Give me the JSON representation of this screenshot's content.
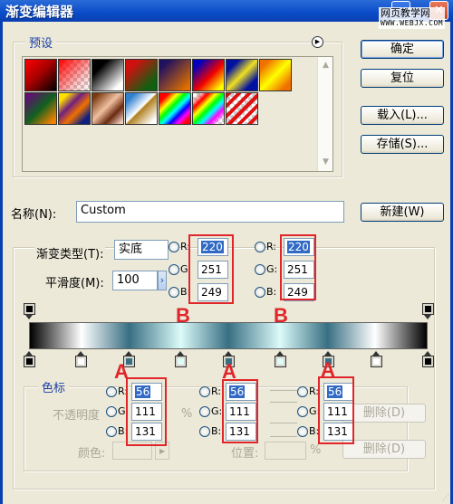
{
  "window": {
    "title": "渐变编辑器",
    "close_glyph": "✕",
    "watermark_line1": "网页教学网",
    "watermark_line2": "WWW.WEBJX.COM"
  },
  "presets": {
    "label": "预设",
    "menu_icon": "▶",
    "swatches": [
      {
        "name": "foreground-to-background",
        "css": "linear-gradient(135deg,#f00 0%,#a00 45%,#000 100%)"
      },
      {
        "name": "foreground-to-transparent",
        "css": "linear-gradient(135deg,#f00 0%,rgba(255,0,0,0.2) 70%,rgba(255,255,255,0) 100%), repeating-conic-gradient(#ccc 0% 25%, #fff 0% 50%) 0 0/8px 8px"
      },
      {
        "name": "black-white",
        "css": "linear-gradient(135deg,#000 25%,#fff 85%)"
      },
      {
        "name": "red-green",
        "css": "linear-gradient(135deg,#d01010 20%,#106010 80%)"
      },
      {
        "name": "violet-orange",
        "css": "linear-gradient(135deg,#201060 15%,#e07000 90%)"
      },
      {
        "name": "blue-red-yellow",
        "css": "linear-gradient(135deg,#0000c0 15%,#f00000 55%,#ffff00 90%)"
      },
      {
        "name": "blue-yellow-blue",
        "css": "linear-gradient(135deg,#0010a0 20%,#f0e020 50%,#0010a0 80%)"
      },
      {
        "name": "orange-yellow-orange",
        "css": "linear-gradient(135deg,#f07000 15%,#ffff00 50%,#f07000 85%)"
      },
      {
        "name": "violet-green-orange",
        "css": "linear-gradient(135deg,#601070 10%,#106020 50%,#f08000 90%)"
      },
      {
        "name": "yellow-violet-orange-blue",
        "css": "linear-gradient(135deg,#ffe000 15%,#702080 38%,#f07000 60%,#102080 85%)"
      },
      {
        "name": "copper",
        "css": "linear-gradient(135deg,#7a3a10 10%,#f0c0a0 45%,#6a2a10 70%,#f0d0c0 95%)"
      },
      {
        "name": "chrome",
        "css": "linear-gradient(135deg,#3080d0 15%,#fff 48%,#b08020 52%,#fff 90%)"
      },
      {
        "name": "spectrum",
        "css": "linear-gradient(135deg,#f00 15%,#ff0 30%,#0f0 42%,#0ff 54%,#00f 66%,#f0f 78%,#f00 90%)"
      },
      {
        "name": "transparent-rainbow",
        "css": "linear-gradient(135deg,rgba(255,0,0,0) 10%,#f00 25%,#ff0 38%,#0f0 50%,#0ff 62%,#f0f 75%,rgba(255,0,255,0) 90%), repeating-conic-gradient(#ccc 0% 25%, #fff 0% 50%) 0 0/8px 8px"
      },
      {
        "name": "transparent-stripes",
        "css": "repeating-linear-gradient(135deg,#e01010 0 4px,rgba(255,255,255,0) 4px 8px), repeating-conic-gradient(#ccc 0% 25%, #fff 0% 50%) 0 0/8px 8px"
      }
    ]
  },
  "buttons": {
    "ok": "确定",
    "reset": "复位",
    "load": "载入(L)...",
    "save": "存储(S)...",
    "new": "新建(W)",
    "delete": "删除(D)"
  },
  "name_field": {
    "label": "名称(N):",
    "value": "Custom"
  },
  "gradient_type": {
    "label": "渐变类型(T):",
    "value": "实底",
    "smoothness_label": "平滑度(M):",
    "smoothness_value": "100",
    "smoothness_unit_arrow": "›"
  },
  "annotations": {
    "b_label": "B",
    "a_label": "A"
  },
  "rgb_panels_b": [
    {
      "r_label": "R:",
      "g_label": "G:",
      "b_label": "B:",
      "r": "220",
      "g": "251",
      "b": "249"
    },
    {
      "r_label": "R:",
      "g_label": "G:",
      "b_label": "B:",
      "r": "220",
      "g": "251",
      "b": "249"
    }
  ],
  "rgb_panels_a": [
    {
      "r_label": "R:",
      "g_label": "G:",
      "b_label": "B:",
      "r": "56",
      "g": "111",
      "b": "131"
    },
    {
      "r_label": "R:",
      "g_label": "G:",
      "b_label": "B:",
      "r": "56",
      "g": "111",
      "b": "131"
    },
    {
      "r_label": "R:",
      "g_label": "G:",
      "b_label": "B:",
      "r": "56",
      "g": "111",
      "b": "131"
    }
  ],
  "gradient": {
    "opacity_stops": [
      {
        "position_pct": 0,
        "color": "#000000"
      },
      {
        "position_pct": 100,
        "color": "#000000"
      }
    ],
    "color_stops": [
      {
        "position_pct": 0,
        "color": "#000000"
      },
      {
        "position_pct": 13,
        "color": "#ffffff"
      },
      {
        "position_pct": 25,
        "color": "#386f83"
      },
      {
        "position_pct": 38,
        "color": "#dcfbf9"
      },
      {
        "position_pct": 50,
        "color": "#386f83"
      },
      {
        "position_pct": 63,
        "color": "#dcfbf9"
      },
      {
        "position_pct": 75,
        "color": "#386f83"
      },
      {
        "position_pct": 87,
        "color": "#ffffff"
      },
      {
        "position_pct": 100,
        "color": "#000000"
      }
    ]
  },
  "stops_group": {
    "label": "色标",
    "opacity_label": "不透明度",
    "percent": "%",
    "color_label": "颜色:",
    "position_label": "位置:",
    "percent2": "%"
  }
}
